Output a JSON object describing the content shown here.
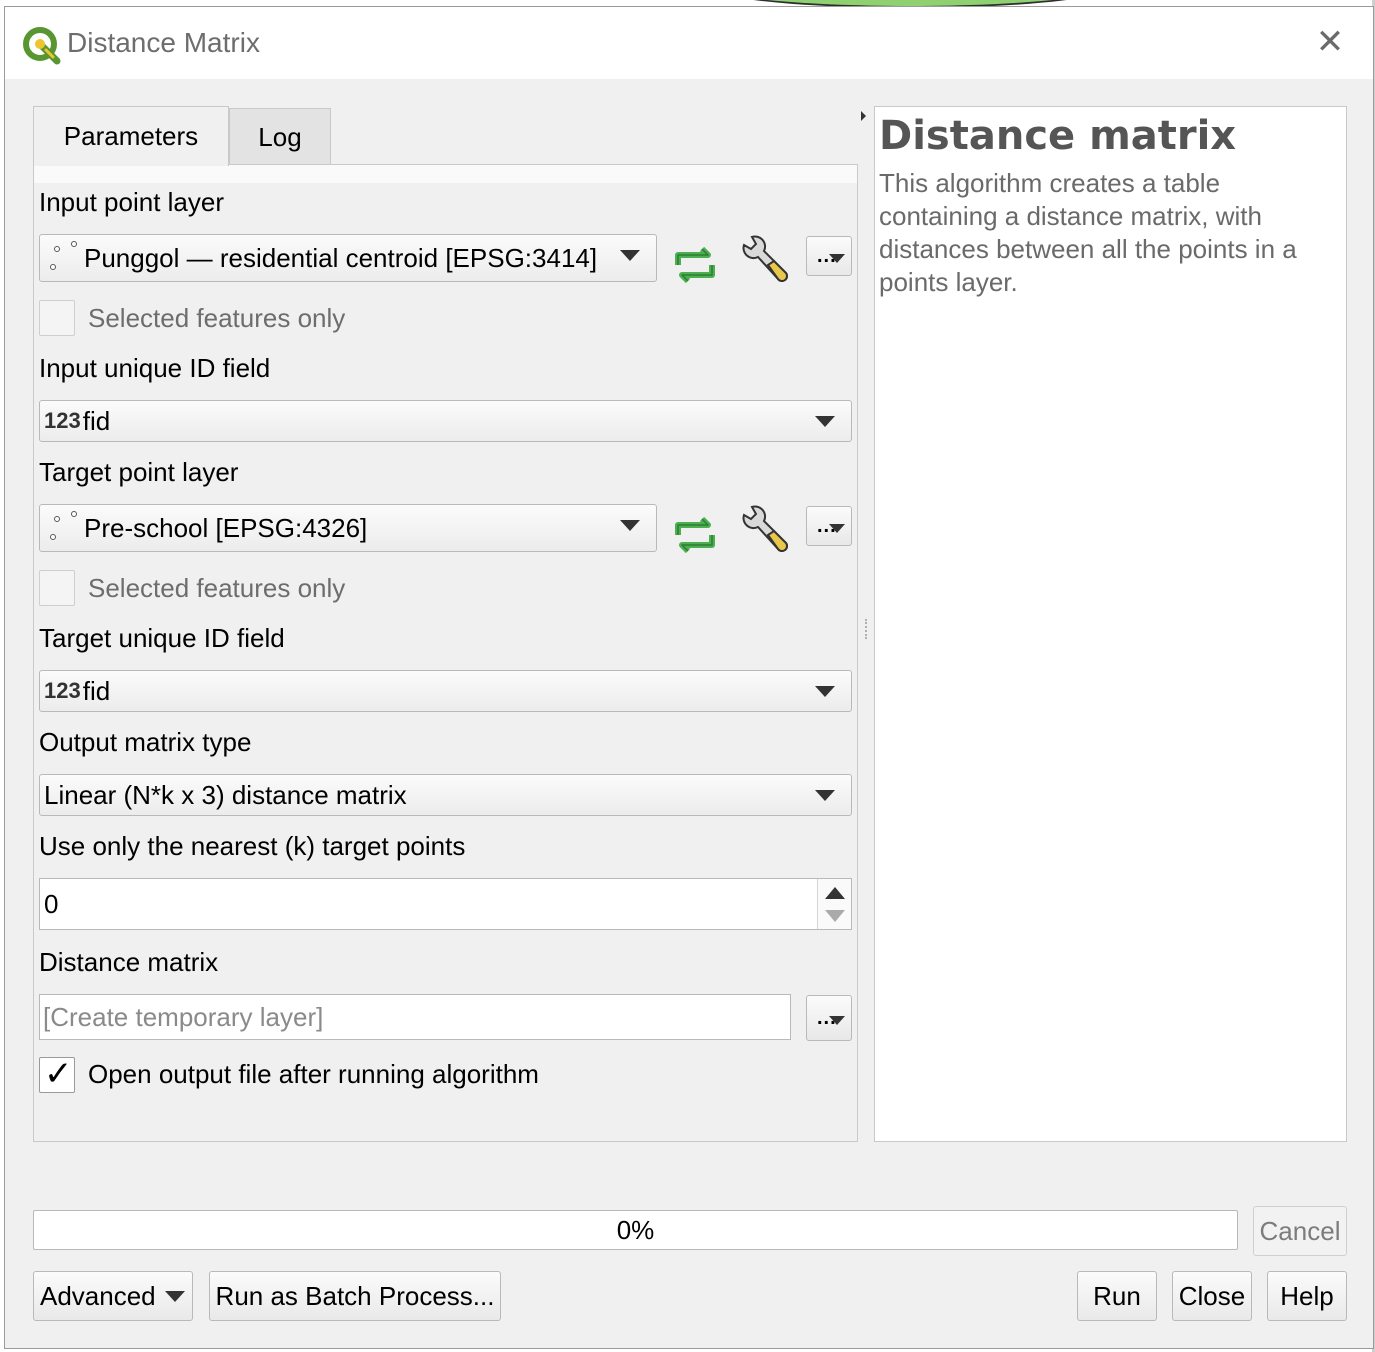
{
  "window": {
    "title": "Distance Matrix",
    "close_icon": "close-icon"
  },
  "tabs": [
    {
      "label": "Parameters",
      "active": true
    },
    {
      "label": "Log",
      "active": false
    }
  ],
  "params": {
    "input_layer": {
      "label": "Input point layer",
      "value": "Punggol — residential centroid [EPSG:3414]",
      "selected_only_label": "Selected features only",
      "selected_only_checked": false
    },
    "input_id": {
      "label": "Input unique ID field",
      "type_badge": "123",
      "value": "fid"
    },
    "target_layer": {
      "label": "Target point layer",
      "value": "Pre-school [EPSG:4326]",
      "selected_only_label": "Selected features only",
      "selected_only_checked": false
    },
    "target_id": {
      "label": "Target unique ID field",
      "type_badge": "123",
      "value": "fid"
    },
    "matrix_type": {
      "label": "Output matrix type",
      "value": "Linear (N*k x 3) distance matrix"
    },
    "nearest_k": {
      "label": "Use only the nearest (k) target points",
      "value": "0"
    },
    "output": {
      "label": "Distance matrix",
      "placeholder": "[Create temporary layer]",
      "open_after_label": "Open output file after running algorithm",
      "open_after_checked": true
    },
    "browse_label": "..."
  },
  "help": {
    "title": "Distance matrix",
    "body": "This algorithm creates a table containing a distance matrix, with distances between all the points in a points layer."
  },
  "progress": {
    "text": "0%",
    "value": 0
  },
  "buttons": {
    "cancel": "Cancel",
    "advanced": "Advanced",
    "batch": "Run as Batch Process...",
    "run": "Run",
    "close": "Close",
    "help": "Help"
  },
  "colors": {
    "qgis_green": "#589632",
    "qgis_yellow": "#eec52e",
    "refresh_green": "#4caf50"
  }
}
